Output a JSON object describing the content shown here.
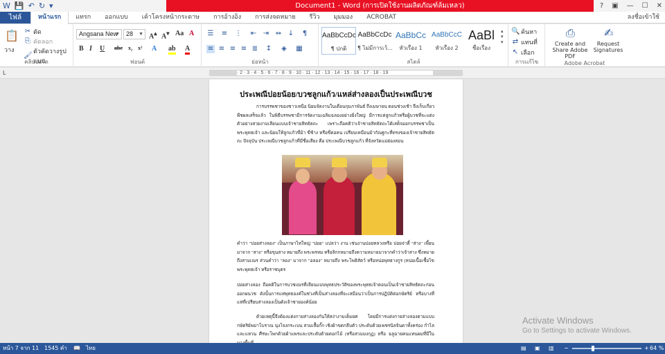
{
  "window": {
    "title": "Document1 -  Word (การเปิดใช้งานผลิตภัณฑ์ล้มเหลว)",
    "signin": "ลงชื่อเข้าใช้"
  },
  "qat": {
    "word_icon": "word-icon",
    "save_icon": "save-icon",
    "undo_icon": "undo-icon",
    "redo_icon": "redo-icon"
  },
  "tabs": {
    "file": "ไฟล์",
    "items": [
      "หน้าแรก",
      "แทรก",
      "ออกแบบ",
      "เค้าโครงหน้ากระดาษ",
      "การอ้างอิง",
      "การส่งจดหมาย",
      "รีวิว",
      "มุมมอง",
      "ACROBAT"
    ]
  },
  "ribbon": {
    "clipboard": {
      "paste": "วาง",
      "cut": "ตัด",
      "copy": "คัดลอก",
      "format_painter": "ตัวคัดวางรูปแบบ",
      "label": "คลิปบอร์ด"
    },
    "font": {
      "name": "Angsana New",
      "size": "28",
      "label": "ฟอนต์"
    },
    "paragraph": {
      "label": "ย่อหน้า"
    },
    "styles": {
      "items": [
        {
          "sample": "AaBbCcDc",
          "name": "¶ ปกติ"
        },
        {
          "sample": "AaBbCcDc",
          "name": "¶ ไม่มีการเว้..."
        },
        {
          "sample": "AaBbCc",
          "name": "หัวเรื่อง 1"
        },
        {
          "sample": "AaBbCcC",
          "name": "หัวเรื่อง 2"
        },
        {
          "sample": "AaBl",
          "name": "ชื่อเรื่อง"
        }
      ],
      "label": "สไตล์"
    },
    "editing": {
      "find": "ค้นหา",
      "replace": "แทนที่",
      "select": "เลือก",
      "label": "การแก้ไข"
    },
    "acrobat": {
      "create_share": "Create and Share Adobe PDF",
      "request_sig": "Request Signatures",
      "label": "Adobe Acrobat"
    }
  },
  "ruler": {
    "ticks": "· 2 · 1 · · · 1 · 2 · 3 · 4 · 5 · 6 · 7 · 8 · 9 · 10 · 11 · 12 · 13 · 14 · 15 · 16 · 17 · 18 · 19"
  },
  "document": {
    "title": "ประเพณีปอยน้อย/บวชลูกแก้ว/แหล่ส่างลองเป็นประเพณีบวช",
    "para1": "การบรรพชาของชาวเหนือ นิยมจัดงานในเดือนกุมภาพันธ์ ถึงเมษายน ตอนช่วงเช้า จึงเก็บเกี่ยวพืชผลเสร็จแล้ว ในพิธีบรรพชามีการจัดงานเฉลิมฉลองอย่างยิ่งใหญ่ มีการแห่ลูกแก้วหรือผู้บวชที่จะแต่งตัวอย่างสวยงามเลียนแบบเจ้าชายสิทธัตถะ เพราะถือคติว่าเจ้าชายสิทธัตถะได้เสด็จออกบรรพชาเป็นพระพุทธเจ้า และนิยมให้ลูกแก้วขี่ม้า ขี่ช้าง หรือขี่คอคน เปรียบเหมือนม้ากัณฐกะที่ทรงของเจ้าชายสิทธัตถะ ปัจจุบัน ประเพณีบวชลูกแก้วที่มีชื่อเสียง คือ ประเพณีบวชลูกแก้ว ที่จังหวัดแม่ฮ่องสอน",
    "para2": "คำว่า \"ปอยส่างลอง\" เป็นภาษาไทใหญ่ \"ปอย\" แปลว่า งาน เช่นงานปอยหลวงหรือ ปอยจ่าตี๋ \"ส่าง\" เพี้ยนมาจาก \"สาง\" หรือขุนสาง หมายถึง พระพรหม หรือลิกกหมายถึงความหมายมาจากคำว่าเจ้าสาง ซึ่งหมายถึงสามเณร ส่วนคำว่า \"ลอง\" มาจาก \"อลอง\" หมายถึง พระโพธิสัตว์ หรือหน่อพุทธางกูร (หน่อเนื้อเชื้อไขพระพุทธเจ้า หรือราชบุตร",
    "para3": "ปอยส่างลอง ถือคติในการบวชเณรที่เลียนแบบพุทธประวัติของพระพุทธเจ้าตอนเป็นเจ้าชายสิทธัตถะก่อนออกผนวช ดังนั้นการแห่พุทธองค์ในช่วงที่เป็นส่างลองที่จะเสมือนว่าเป็นการปฏิบัติต่อกษัตริย์ หรือบางที่แห่ที่เปรียบส่างลองเป็นดังเจ้าชายองค์น้อย",
    "para4": "ด้วยเหตุนี้จึงต้องแต่งกายส่างลองกันให้สง่างามเต็มยศ โดยมีการแต่งกายส่างลองตามแบบกษัตริย์พม่าโบราณ นุ่งโจงกระเบน สวมเสื้อกั๊ก เชิงผ้าขดกลีบตัว ประดับด้วยเพชรนิลจินดาทั้งคร่อง กำไล และแหวน ศีรษะโพกด้วยผ้าแพรและประดับด้วยดอกไม้ (หรือสวมมงกุฎ) หรือ ฉลูฉายคนแทนผมที่มีในบางพื้นที่"
  },
  "watermark": {
    "line1": "Activate Windows",
    "line2": "Go to Settings to activate Windows."
  },
  "status": {
    "page": "หน้า 7 จาก 11",
    "words": "1545 คำ",
    "lang": "ไทย",
    "zoom": "64 %",
    "zoom_percent": 64
  },
  "colors": {
    "brand": "#2b579a",
    "title_alert": "#e81123"
  }
}
